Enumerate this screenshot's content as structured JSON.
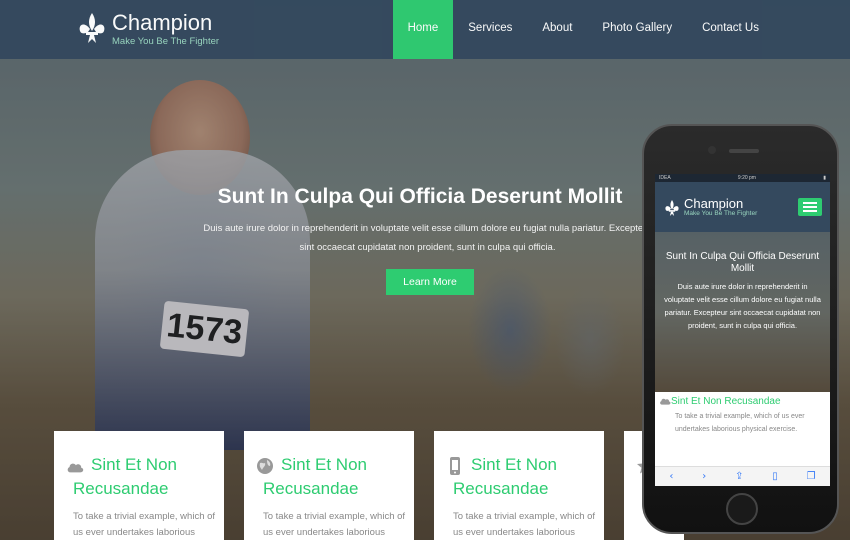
{
  "brand": {
    "name": "Champion",
    "tagline": "Make You Be The Fighter",
    "accent_color": "#2ecc71",
    "header_color": "#34495e"
  },
  "nav": {
    "items": [
      {
        "label": "Home",
        "active": true
      },
      {
        "label": "Services",
        "active": false
      },
      {
        "label": "About",
        "active": false
      },
      {
        "label": "Photo Gallery",
        "active": false
      },
      {
        "label": "Contact Us",
        "active": false
      }
    ]
  },
  "hero": {
    "bib_number": "1573",
    "title": "Sunt In Culpa Qui Officia Deserunt Mollit",
    "text": "Duis aute irure dolor in reprehenderit in voluptate velit esse cillum dolore eu fugiat nulla pariatur. Excepteur sint occaecat cupidatat non proident, sunt in culpa qui officia.",
    "button_label": "Learn More"
  },
  "features": [
    {
      "icon": "cloud-icon",
      "title": "Sint Et Non Recusandae",
      "text": "To take a trivial example, which of us ever undertakes laborious"
    },
    {
      "icon": "globe-icon",
      "title": "Sint Et Non Recusandae",
      "text": "To take a trivial example, which of us ever undertakes laborious"
    },
    {
      "icon": "phone-icon",
      "title": "Sint Et Non Recusandae",
      "text": "To take a trivial example, which of us ever undertakes laborious"
    },
    {
      "icon": "star-icon",
      "title": "",
      "text": ""
    }
  ],
  "mobile": {
    "status_left": "IDEA",
    "status_time": "9:20 pm",
    "hero_title": "Sunt In Culpa Qui Officia Deserunt Mollit",
    "hero_text": "Duis aute irure dolor in reprehenderit in voluptate velit esse cillum dolore eu fugiat nulla pariatur. Excepteur sint occaecat cupidatat non proident, sunt in culpa qui officia.",
    "card_title": "Sint Et Non Recusandae",
    "card_text": "To take a trivial example, which of us ever undertakes laborious physical exercise."
  }
}
